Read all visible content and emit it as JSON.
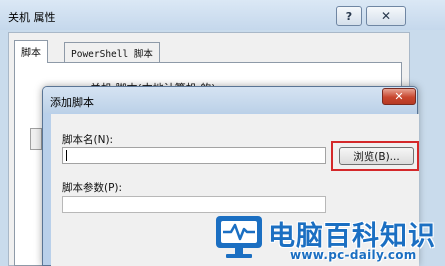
{
  "back_window": {
    "title": "关机 属性",
    "help_label": "?",
    "close_label": "✕",
    "tabs": [
      {
        "label": "脚本"
      },
      {
        "label": "PowerShell 脚本"
      }
    ],
    "description": "关机 脚本(本地计算机 的)"
  },
  "dialog": {
    "title": "添加脚本",
    "close_label": "✕",
    "script_name_label": "脚本名(N):",
    "script_name_value": "",
    "browse_label": "浏览(B)...",
    "script_params_label": "脚本参数(P):",
    "script_params_value": ""
  },
  "watermark": {
    "brand": "电脑百科知识",
    "url": "www.pc-daily.com"
  },
  "colors": {
    "highlight": "#d4282a",
    "brand_blue": "#1b6fc2",
    "close_red": "#c8462e"
  }
}
